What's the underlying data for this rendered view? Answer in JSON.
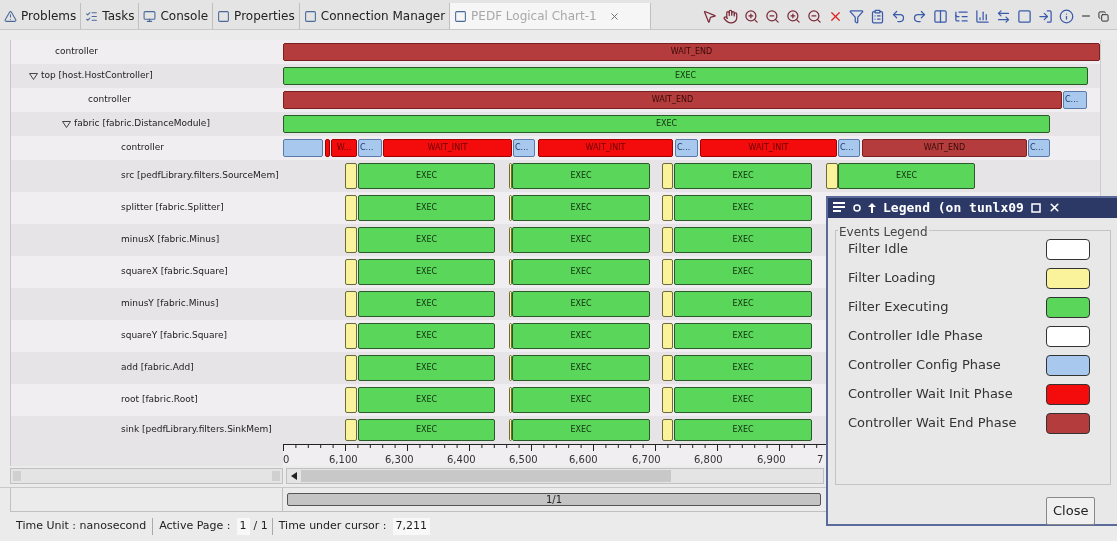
{
  "tabs": [
    {
      "label": "Problems",
      "selected": false
    },
    {
      "label": "Tasks",
      "selected": false
    },
    {
      "label": "Console",
      "selected": false
    },
    {
      "label": "Properties",
      "selected": false
    },
    {
      "label": "Connection Manager",
      "selected": false
    },
    {
      "label": "PEDF Logical Chart-1",
      "selected": true
    }
  ],
  "tree": [
    {
      "label": "controller",
      "bars": [
        {
          "kind": "wait_end",
          "label": "WAIT_END"
        }
      ]
    },
    {
      "label": "top [host.HostController]",
      "expanded": true,
      "bars": [
        {
          "kind": "exec",
          "label": "EXEC"
        }
      ],
      "children": [
        {
          "label": "controller",
          "bars": [
            {
              "kind": "wait_end",
              "label": "WAIT_END"
            },
            {
              "kind": "config",
              "label": "C..."
            }
          ]
        },
        {
          "label": "fabric [fabric.DistanceModule]",
          "expanded": true,
          "bars": [
            {
              "kind": "exec",
              "label": "EXEC"
            }
          ],
          "children": [
            {
              "label": "controller",
              "bars": [
                {
                  "kind": "config"
                },
                {
                  "kind": "wait_init"
                },
                {
                  "kind": "wait_init",
                  "label": "W..."
                },
                {
                  "kind": "config",
                  "label": "C..."
                },
                {
                  "kind": "wait_init",
                  "label": "WAIT_INIT"
                },
                {
                  "kind": "config",
                  "label": "C..."
                },
                {
                  "kind": "wait_init",
                  "label": "WAIT_INIT"
                },
                {
                  "kind": "config",
                  "label": "C..."
                },
                {
                  "kind": "wait_init",
                  "label": "WAIT_INIT"
                },
                {
                  "kind": "config",
                  "label": "C..."
                },
                {
                  "kind": "wait_end",
                  "label": "WAIT_END"
                },
                {
                  "kind": "config",
                  "label": "C..."
                }
              ]
            },
            {
              "label": "src [pedfLibrary.filters.SourceMem]",
              "bars": [
                {
                  "kind": "load"
                },
                {
                  "kind": "exec",
                  "label": "EXEC"
                },
                {
                  "kind": "load"
                },
                {
                  "kind": "exec",
                  "label": "EXEC"
                },
                {
                  "kind": "load"
                },
                {
                  "kind": "exec",
                  "label": "EXEC"
                },
                {
                  "kind": "load"
                },
                {
                  "kind": "exec",
                  "label": "EXEC"
                }
              ]
            },
            {
              "label": "splitter [fabric.Splitter]",
              "bars": [
                {
                  "kind": "load"
                },
                {
                  "kind": "exec",
                  "label": "EXEC"
                },
                {
                  "kind": "load"
                },
                {
                  "kind": "exec",
                  "label": "EXEC"
                },
                {
                  "kind": "load"
                },
                {
                  "kind": "exec",
                  "label": "EXEC"
                }
              ]
            },
            {
              "label": "minusX [fabric.Minus]",
              "bars": [
                {
                  "kind": "load"
                },
                {
                  "kind": "exec",
                  "label": "EXEC"
                },
                {
                  "kind": "load"
                },
                {
                  "kind": "exec",
                  "label": "EXEC"
                },
                {
                  "kind": "load"
                },
                {
                  "kind": "exec",
                  "label": "EXEC"
                }
              ]
            },
            {
              "label": "squareX [fabric.Square]",
              "bars": [
                {
                  "kind": "load"
                },
                {
                  "kind": "exec",
                  "label": "EXEC"
                },
                {
                  "kind": "load"
                },
                {
                  "kind": "exec",
                  "label": "EXEC"
                },
                {
                  "kind": "load"
                },
                {
                  "kind": "exec",
                  "label": "EXEC"
                }
              ]
            },
            {
              "label": "minusY [fabric.Minus]",
              "bars": [
                {
                  "kind": "load"
                },
                {
                  "kind": "exec",
                  "label": "EXEC"
                },
                {
                  "kind": "load"
                },
                {
                  "kind": "exec",
                  "label": "EXEC"
                },
                {
                  "kind": "load"
                },
                {
                  "kind": "exec",
                  "label": "EXEC"
                }
              ]
            },
            {
              "label": "squareY [fabric.Square]",
              "bars": [
                {
                  "kind": "load"
                },
                {
                  "kind": "exec",
                  "label": "EXEC"
                },
                {
                  "kind": "load"
                },
                {
                  "kind": "exec",
                  "label": "EXEC"
                },
                {
                  "kind": "load"
                },
                {
                  "kind": "exec",
                  "label": "EXEC"
                }
              ]
            },
            {
              "label": "add [fabric.Add]",
              "bars": [
                {
                  "kind": "load"
                },
                {
                  "kind": "exec",
                  "label": "EXEC"
                },
                {
                  "kind": "load"
                },
                {
                  "kind": "exec",
                  "label": "EXEC"
                },
                {
                  "kind": "load"
                },
                {
                  "kind": "exec",
                  "label": "EXEC"
                }
              ]
            },
            {
              "label": "root [fabric.Root]",
              "bars": [
                {
                  "kind": "load"
                },
                {
                  "kind": "exec",
                  "label": "EXEC"
                },
                {
                  "kind": "load"
                },
                {
                  "kind": "exec",
                  "label": "EXEC"
                },
                {
                  "kind": "load"
                },
                {
                  "kind": "exec",
                  "label": "EXEC"
                }
              ]
            },
            {
              "label": "sink [pedfLibrary.filters.SinkMem]",
              "bars": [
                {
                  "kind": "load"
                },
                {
                  "kind": "exec",
                  "label": "EXEC"
                },
                {
                  "kind": "load"
                },
                {
                  "kind": "exec",
                  "label": "EXEC"
                },
                {
                  "kind": "load"
                },
                {
                  "kind": "exec",
                  "label": "EXEC"
                }
              ]
            }
          ]
        }
      ]
    }
  ],
  "axis_labels": [
    "0",
    "6,100",
    "6,300",
    "6,400",
    "6,500",
    "6,600",
    "6,700",
    "6,800",
    "6,900",
    "7"
  ],
  "page_indicator": "1/1",
  "status_bar": {
    "time_unit": "Time Unit : nanosecond",
    "active_page_label": "Active Page :",
    "active_page": "1",
    "page_total": "/ 1",
    "cursor_label": "Time under cursor :",
    "cursor_value": "7,211"
  },
  "legend": {
    "title": "Legend (on tunlx09",
    "group": "Events Legend",
    "close": "Close",
    "items": [
      {
        "label": "Filter Idle",
        "color": "#ffffff"
      },
      {
        "label": "Filter Loading",
        "color": "#fbf39c"
      },
      {
        "label": "Filter Executing",
        "color": "#5ad65a"
      },
      {
        "label": "Controller Idle Phase",
        "color": "#ffffff"
      },
      {
        "label": "Controller Config Phase",
        "color": "#a8c8ee"
      },
      {
        "label": "Controller Wait Init Phase",
        "color": "#f40c0c"
      },
      {
        "label": "Controller Wait End Phase",
        "color": "#b43c3c"
      }
    ]
  }
}
